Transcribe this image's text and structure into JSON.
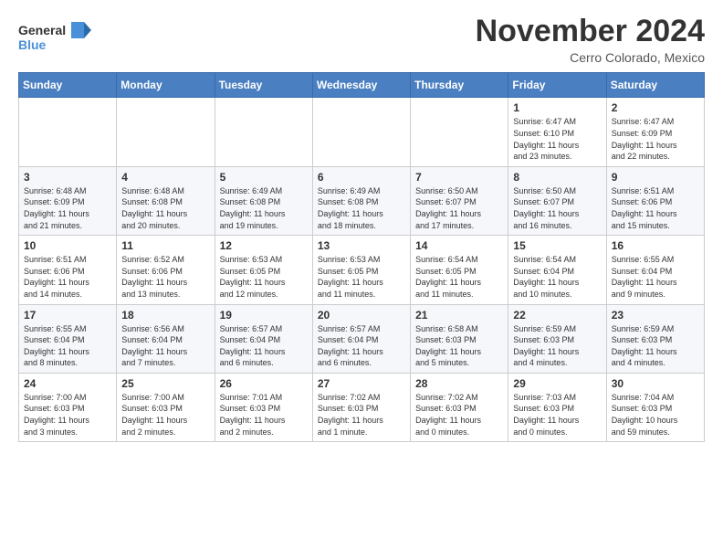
{
  "header": {
    "logo_line1": "General",
    "logo_line2": "Blue",
    "month": "November 2024",
    "location": "Cerro Colorado, Mexico"
  },
  "weekdays": [
    "Sunday",
    "Monday",
    "Tuesday",
    "Wednesday",
    "Thursday",
    "Friday",
    "Saturday"
  ],
  "weeks": [
    [
      {
        "day": "",
        "info": ""
      },
      {
        "day": "",
        "info": ""
      },
      {
        "day": "",
        "info": ""
      },
      {
        "day": "",
        "info": ""
      },
      {
        "day": "",
        "info": ""
      },
      {
        "day": "1",
        "info": "Sunrise: 6:47 AM\nSunset: 6:10 PM\nDaylight: 11 hours\nand 23 minutes."
      },
      {
        "day": "2",
        "info": "Sunrise: 6:47 AM\nSunset: 6:09 PM\nDaylight: 11 hours\nand 22 minutes."
      }
    ],
    [
      {
        "day": "3",
        "info": "Sunrise: 6:48 AM\nSunset: 6:09 PM\nDaylight: 11 hours\nand 21 minutes."
      },
      {
        "day": "4",
        "info": "Sunrise: 6:48 AM\nSunset: 6:08 PM\nDaylight: 11 hours\nand 20 minutes."
      },
      {
        "day": "5",
        "info": "Sunrise: 6:49 AM\nSunset: 6:08 PM\nDaylight: 11 hours\nand 19 minutes."
      },
      {
        "day": "6",
        "info": "Sunrise: 6:49 AM\nSunset: 6:08 PM\nDaylight: 11 hours\nand 18 minutes."
      },
      {
        "day": "7",
        "info": "Sunrise: 6:50 AM\nSunset: 6:07 PM\nDaylight: 11 hours\nand 17 minutes."
      },
      {
        "day": "8",
        "info": "Sunrise: 6:50 AM\nSunset: 6:07 PM\nDaylight: 11 hours\nand 16 minutes."
      },
      {
        "day": "9",
        "info": "Sunrise: 6:51 AM\nSunset: 6:06 PM\nDaylight: 11 hours\nand 15 minutes."
      }
    ],
    [
      {
        "day": "10",
        "info": "Sunrise: 6:51 AM\nSunset: 6:06 PM\nDaylight: 11 hours\nand 14 minutes."
      },
      {
        "day": "11",
        "info": "Sunrise: 6:52 AM\nSunset: 6:06 PM\nDaylight: 11 hours\nand 13 minutes."
      },
      {
        "day": "12",
        "info": "Sunrise: 6:53 AM\nSunset: 6:05 PM\nDaylight: 11 hours\nand 12 minutes."
      },
      {
        "day": "13",
        "info": "Sunrise: 6:53 AM\nSunset: 6:05 PM\nDaylight: 11 hours\nand 11 minutes."
      },
      {
        "day": "14",
        "info": "Sunrise: 6:54 AM\nSunset: 6:05 PM\nDaylight: 11 hours\nand 11 minutes."
      },
      {
        "day": "15",
        "info": "Sunrise: 6:54 AM\nSunset: 6:04 PM\nDaylight: 11 hours\nand 10 minutes."
      },
      {
        "day": "16",
        "info": "Sunrise: 6:55 AM\nSunset: 6:04 PM\nDaylight: 11 hours\nand 9 minutes."
      }
    ],
    [
      {
        "day": "17",
        "info": "Sunrise: 6:55 AM\nSunset: 6:04 PM\nDaylight: 11 hours\nand 8 minutes."
      },
      {
        "day": "18",
        "info": "Sunrise: 6:56 AM\nSunset: 6:04 PM\nDaylight: 11 hours\nand 7 minutes."
      },
      {
        "day": "19",
        "info": "Sunrise: 6:57 AM\nSunset: 6:04 PM\nDaylight: 11 hours\nand 6 minutes."
      },
      {
        "day": "20",
        "info": "Sunrise: 6:57 AM\nSunset: 6:04 PM\nDaylight: 11 hours\nand 6 minutes."
      },
      {
        "day": "21",
        "info": "Sunrise: 6:58 AM\nSunset: 6:03 PM\nDaylight: 11 hours\nand 5 minutes."
      },
      {
        "day": "22",
        "info": "Sunrise: 6:59 AM\nSunset: 6:03 PM\nDaylight: 11 hours\nand 4 minutes."
      },
      {
        "day": "23",
        "info": "Sunrise: 6:59 AM\nSunset: 6:03 PM\nDaylight: 11 hours\nand 4 minutes."
      }
    ],
    [
      {
        "day": "24",
        "info": "Sunrise: 7:00 AM\nSunset: 6:03 PM\nDaylight: 11 hours\nand 3 minutes."
      },
      {
        "day": "25",
        "info": "Sunrise: 7:00 AM\nSunset: 6:03 PM\nDaylight: 11 hours\nand 2 minutes."
      },
      {
        "day": "26",
        "info": "Sunrise: 7:01 AM\nSunset: 6:03 PM\nDaylight: 11 hours\nand 2 minutes."
      },
      {
        "day": "27",
        "info": "Sunrise: 7:02 AM\nSunset: 6:03 PM\nDaylight: 11 hours\nand 1 minute."
      },
      {
        "day": "28",
        "info": "Sunrise: 7:02 AM\nSunset: 6:03 PM\nDaylight: 11 hours\nand 0 minutes."
      },
      {
        "day": "29",
        "info": "Sunrise: 7:03 AM\nSunset: 6:03 PM\nDaylight: 11 hours\nand 0 minutes."
      },
      {
        "day": "30",
        "info": "Sunrise: 7:04 AM\nSunset: 6:03 PM\nDaylight: 10 hours\nand 59 minutes."
      }
    ]
  ]
}
